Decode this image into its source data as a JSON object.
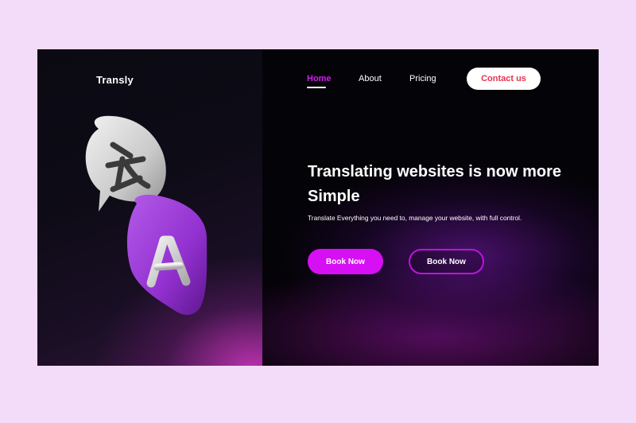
{
  "brand": {
    "name": "Transly"
  },
  "nav": {
    "items": [
      {
        "label": "Home",
        "active": true
      },
      {
        "label": "About"
      },
      {
        "label": "Pricing"
      }
    ],
    "contact_label": "Contact us"
  },
  "hero": {
    "headline": "Translating websites is now more Simple",
    "subtext": "Translate Everything you need to, manage your website, with full control.",
    "primary_cta": "Book Now",
    "secondary_cta": "Book Now"
  },
  "illustration": {
    "icons": [
      "chinese-character-bubble-icon",
      "letter-a-bubble-icon"
    ]
  },
  "colors": {
    "accent": "#d70ff5",
    "contact_text": "#e5324f",
    "background": "#050308",
    "page_bg": "#f3dcf9"
  }
}
